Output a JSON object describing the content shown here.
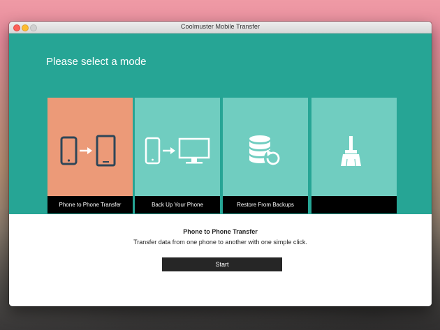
{
  "window": {
    "title": "Coolmuster Mobile Transfer"
  },
  "main": {
    "heading": "Please select a mode",
    "modes": [
      {
        "label": "Phone to Phone Transfer",
        "icon": "phone-to-phone-icon",
        "selected": true
      },
      {
        "label": "Back Up Your Phone",
        "icon": "phone-to-computer-icon",
        "selected": false
      },
      {
        "label": "Restore From Backups",
        "icon": "database-restore-icon",
        "selected": false
      },
      {
        "label": "",
        "icon": "broom-icon",
        "selected": false
      }
    ],
    "selected_mode": {
      "title": "Phone to Phone Transfer",
      "description": "Transfer data from one phone to another with one simple click."
    },
    "start_label": "Start"
  },
  "colors": {
    "accent": "#26a595",
    "tile": "#70cdc0",
    "tile_selected": "#ec9a78",
    "caption_bg": "#000000"
  }
}
